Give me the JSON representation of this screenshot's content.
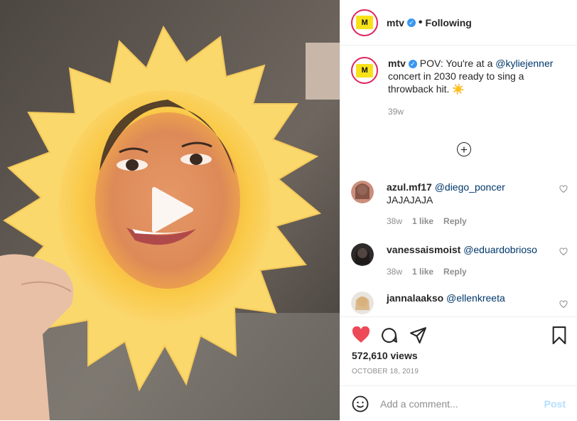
{
  "header": {
    "username": "mtv",
    "separator": "•",
    "follow_status": "Following"
  },
  "caption": {
    "username": "mtv",
    "text_before": "POV: You're at a ",
    "mention": "@kyliejenner",
    "text_after": " concert in 2030 ready to sing a throwback hit. ☀️",
    "time": "39w"
  },
  "comments": [
    {
      "username": "azul.mf17",
      "mention": "@diego_poncer",
      "text": "JAJAJAJA",
      "time": "38w",
      "likes": "1 like",
      "reply": "Reply"
    },
    {
      "username": "vanessaismoist",
      "mention": "@eduardobrioso",
      "text": "",
      "time": "38w",
      "likes": "1 like",
      "reply": "Reply"
    },
    {
      "username": "jannalaakso",
      "mention": "@ellenkreeta",
      "text": "",
      "time": "",
      "likes": "",
      "reply": ""
    }
  ],
  "stats": {
    "views": "572,610 views",
    "date": "OCTOBER 18, 2019"
  },
  "add_comment": {
    "placeholder": "Add a comment...",
    "post_label": "Post"
  },
  "icons": {
    "like": "heart-filled-icon",
    "comment": "comment-icon",
    "share": "share-icon",
    "save": "bookmark-icon",
    "emoji": "emoji-icon",
    "play": "play-icon",
    "more": "plus-circle-icon"
  },
  "colors": {
    "like_red": "#ed4956",
    "link_blue": "#00376b",
    "verified_blue": "#3897f0",
    "post_disabled": "#b2dffc",
    "meta_gray": "#8e8e8e"
  }
}
